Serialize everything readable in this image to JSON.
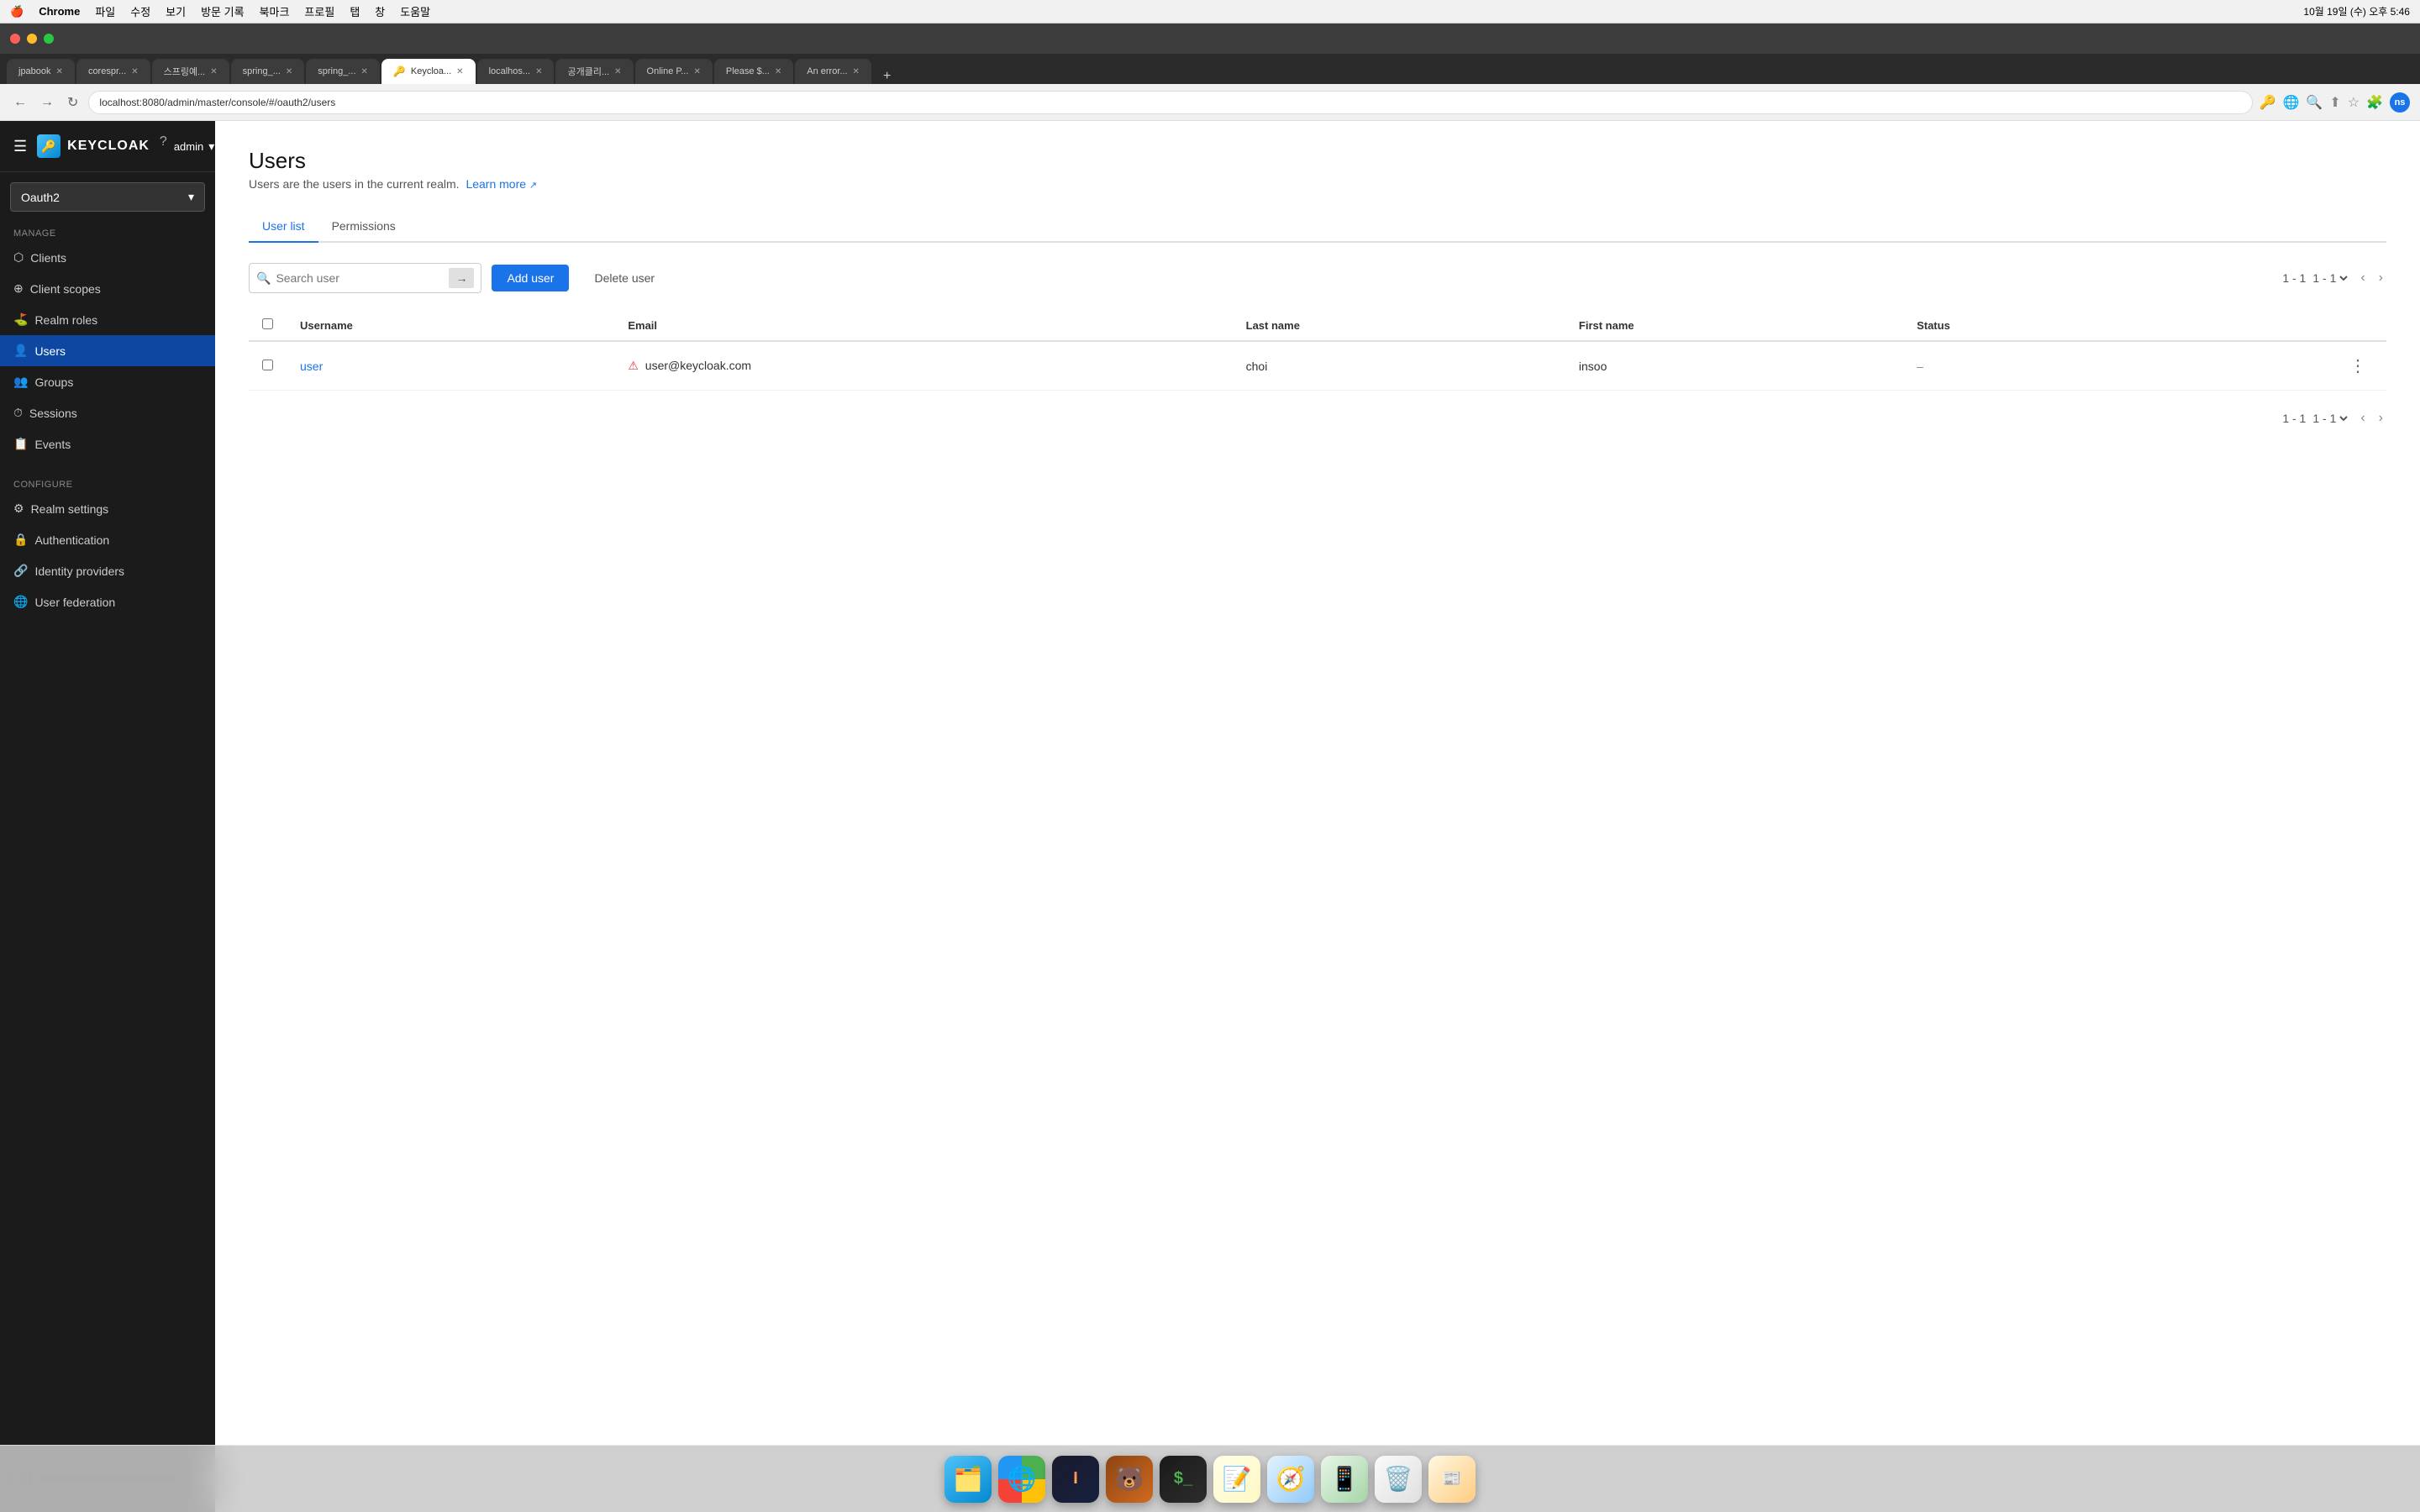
{
  "macbar": {
    "apple": "🍎",
    "app_name": "Chrome",
    "menus": [
      "파일",
      "수정",
      "보기",
      "방문 기록",
      "북마크",
      "프로필",
      "탭",
      "창",
      "도움말"
    ],
    "time": "10월 19일 (수) 오후 5:46"
  },
  "browser": {
    "tabs": [
      {
        "label": "jpabook",
        "active": false
      },
      {
        "label": "corespr...",
        "active": false
      },
      {
        "label": "스프링예...",
        "active": false
      },
      {
        "label": "spring_...",
        "active": false
      },
      {
        "label": "spring_...",
        "active": false
      },
      {
        "label": "Keycloa...",
        "active": true
      },
      {
        "label": "localhos...",
        "active": false
      },
      {
        "label": "공개클리...",
        "active": false
      },
      {
        "label": "Online P...",
        "active": false
      },
      {
        "label": "Please $...",
        "active": false
      },
      {
        "label": "An error...",
        "active": false
      }
    ],
    "url": "localhost:8080/admin/master/console/#/oauth2/users"
  },
  "keycloak": {
    "logo_text": "KEYCLOAK",
    "realm": "Oauth2",
    "header": {
      "help_icon": "?",
      "admin_label": "admin",
      "admin_dropdown": "▾"
    },
    "sidebar": {
      "manage_label": "Manage",
      "items_manage": [
        {
          "id": "clients",
          "label": "Clients"
        },
        {
          "id": "client-scopes",
          "label": "Client scopes"
        },
        {
          "id": "realm-roles",
          "label": "Realm roles"
        },
        {
          "id": "users",
          "label": "Users",
          "active": true
        },
        {
          "id": "groups",
          "label": "Groups"
        },
        {
          "id": "sessions",
          "label": "Sessions"
        },
        {
          "id": "events",
          "label": "Events"
        }
      ],
      "configure_label": "Configure",
      "items_configure": [
        {
          "id": "realm-settings",
          "label": "Realm settings"
        },
        {
          "id": "authentication",
          "label": "Authentication"
        },
        {
          "id": "identity-providers",
          "label": "Identity providers"
        },
        {
          "id": "user-federation",
          "label": "User federation"
        }
      ]
    },
    "users_page": {
      "title": "Users",
      "subtitle": "Users are the users in the current realm.",
      "learn_more": "Learn more",
      "tabs": [
        {
          "id": "user-list",
          "label": "User list",
          "active": true
        },
        {
          "id": "permissions",
          "label": "Permissions",
          "active": false
        }
      ],
      "search_placeholder": "Search user",
      "add_user_btn": "Add user",
      "delete_user_btn": "Delete user",
      "pagination": "1 - 1",
      "table": {
        "columns": [
          "Username",
          "Email",
          "Last name",
          "First name",
          "Status"
        ],
        "rows": [
          {
            "username": "user",
            "email": "user@keycloak.com",
            "email_warning": true,
            "last_name": "choi",
            "first_name": "insoo",
            "status": "–"
          }
        ]
      }
    }
  },
  "dock": {
    "items": [
      {
        "id": "finder",
        "icon": "🗂️",
        "label": "Finder"
      },
      {
        "id": "chrome",
        "icon": "🌐",
        "label": "Chrome"
      },
      {
        "id": "intellij",
        "icon": "🧠",
        "label": "IntelliJ"
      },
      {
        "id": "bear",
        "icon": "🐻",
        "label": "Bear"
      },
      {
        "id": "terminal",
        "icon": "💲",
        "label": "Terminal"
      },
      {
        "id": "notes",
        "icon": "📝",
        "label": "Notes"
      },
      {
        "id": "safari",
        "icon": "🧭",
        "label": "Safari"
      },
      {
        "id": "simulator",
        "icon": "📱",
        "label": "Simulator"
      },
      {
        "id": "trash",
        "icon": "🗑️",
        "label": "Trash"
      },
      {
        "id": "more",
        "icon": "📰",
        "label": "More"
      }
    ]
  }
}
